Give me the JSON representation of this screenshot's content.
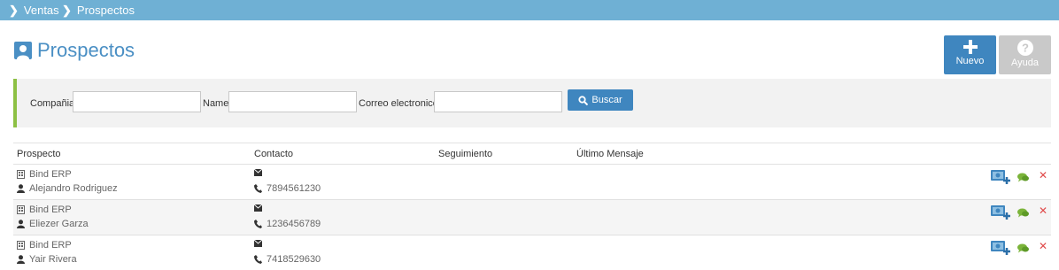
{
  "breadcrumb": {
    "items": [
      {
        "label": "Ventas"
      },
      {
        "label": "Prospectos"
      }
    ]
  },
  "page": {
    "title": "Prospectos"
  },
  "toolbar": {
    "new_label": "Nuevo",
    "help_label": "Ayuda"
  },
  "filters": {
    "company_label": "Compañia",
    "name_label": "Name",
    "email_label": "Correo electronico",
    "company_value": "",
    "name_value": "",
    "email_value": "",
    "search_label": "Buscar"
  },
  "table": {
    "headers": {
      "prospect": "Prospecto",
      "contact": "Contacto",
      "followup": "Seguimiento",
      "last_message": "Último Mensaje"
    },
    "rows": [
      {
        "company": "Bind ERP",
        "person": "Alejandro Rodriguez",
        "phone": "7894561230"
      },
      {
        "company": "Bind ERP",
        "person": "Eliezer Garza",
        "phone": "1236456789"
      },
      {
        "company": "Bind ERP",
        "person": "Yair Rivera",
        "phone": "7418529630"
      }
    ]
  },
  "colors": {
    "accent": "#3f86bf",
    "topbar": "#6fb0d4",
    "filter_border": "#8dc044",
    "help_button": "#c9c9c9",
    "remove": "#e04a4a",
    "chat": "#7bb43a"
  },
  "icons": [
    "chevron-right-icon",
    "user-icon",
    "plus-icon",
    "question-icon",
    "search-icon",
    "building-icon",
    "email-icon",
    "phone-icon",
    "add-contact-icon",
    "chat-icon",
    "remove-icon"
  ]
}
